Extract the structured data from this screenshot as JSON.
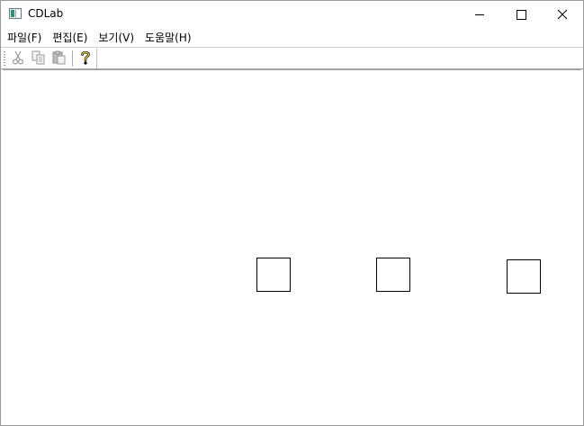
{
  "window": {
    "title": "CDLab",
    "icon": "app-window-icon"
  },
  "menubar": {
    "items": [
      {
        "label": "파일(F)"
      },
      {
        "label": "편집(E)"
      },
      {
        "label": "보기(V)"
      },
      {
        "label": "도움말(H)"
      }
    ]
  },
  "toolbar": {
    "buttons": [
      {
        "icon": "cut-icon",
        "enabled": false
      },
      {
        "icon": "copy-icon",
        "enabled": false
      },
      {
        "icon": "paste-icon",
        "enabled": false
      },
      {
        "icon": "help-icon",
        "enabled": true
      }
    ]
  },
  "canvas": {
    "shapes": [
      {
        "type": "square"
      },
      {
        "type": "square"
      },
      {
        "type": "square"
      }
    ]
  }
}
